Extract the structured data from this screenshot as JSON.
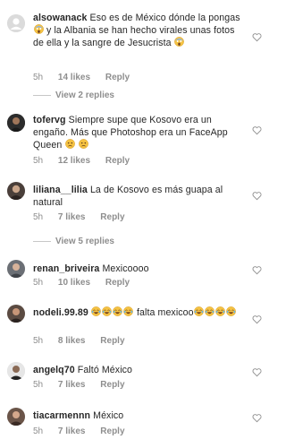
{
  "comments": [
    {
      "username": "alsowanack",
      "text_segments": [
        "Eso es de México dónde la pongas ",
        " y la Albania se han hecho virales unas fotos de ella y la sangre de Jesucrista "
      ],
      "emojis": [
        "scream-emoji",
        "scream-emoji"
      ],
      "time": "5h",
      "likes": "14 likes",
      "reply": "Reply",
      "avatar": "default-avatar"
    },
    {
      "username": "tofervɡ",
      "text_segments": [
        "Siempre supe que Kosovo era un engaño. Más que Photoshop era un FaceApp Queen ",
        " "
      ],
      "emojis": [
        "worried-emoji",
        "worried-emoji"
      ],
      "time": "5h",
      "likes": "12 likes",
      "reply": "Reply"
    },
    {
      "username": "liliana__lilia",
      "text_segments": [
        "La de Kosovo es más guapa al natural"
      ],
      "time": "5h",
      "likes": "7 likes",
      "reply": "Reply"
    },
    {
      "username": "renan_briveira",
      "text_segments": [
        "Mexicoooo"
      ],
      "time": "5h",
      "likes": "10 likes",
      "reply": "Reply"
    },
    {
      "username": "nodeli.99.89",
      "text_segments": [
        "falta mexicoo"
      ],
      "emojis_before": [
        "joy-emoji",
        "joy-emoji",
        "joy-emoji",
        "joy-emoji"
      ],
      "emojis_after": [
        "joy-emoji",
        "joy-emoji",
        "joy-emoji",
        "joy-emoji"
      ],
      "time": "5h",
      "likes": "8 likes",
      "reply": "Reply"
    },
    {
      "username": "angelq70",
      "text_segments": [
        "Faltó México"
      ],
      "time": "5h",
      "likes": "7 likes",
      "reply": "Reply"
    },
    {
      "username": "tiacarmennn",
      "text_segments": [
        "México"
      ],
      "time": "5h",
      "likes": "7 likes",
      "reply": "Reply"
    }
  ],
  "view_replies": [
    "View 2 replies",
    "View 5 replies"
  ],
  "icons": {
    "like": "heart-outline-icon"
  },
  "colors": {
    "text": "#262626",
    "secondary": "#8e8e8e"
  }
}
